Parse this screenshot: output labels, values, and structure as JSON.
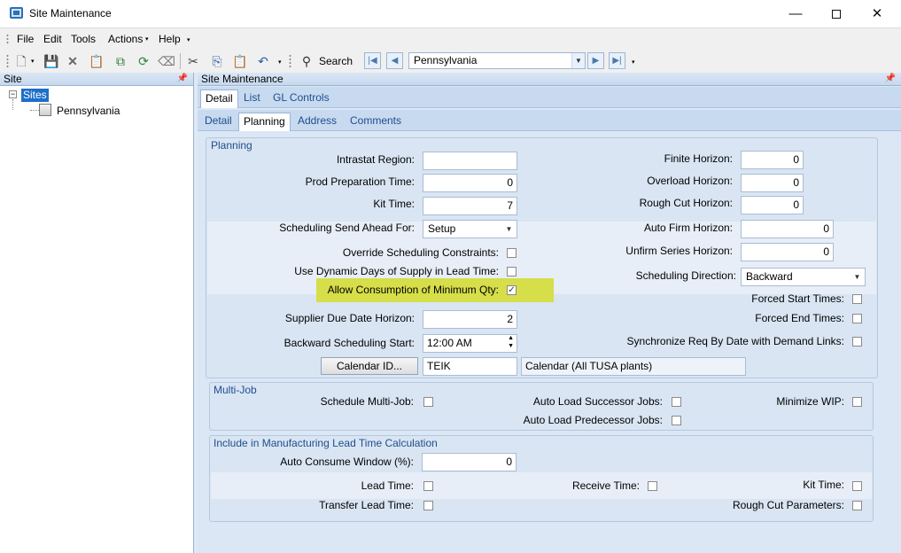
{
  "window": {
    "title": "Site Maintenance",
    "min": "—",
    "close": "✕"
  },
  "menu": [
    "File",
    "Edit",
    "Tools",
    "Actions",
    "Help"
  ],
  "toolbar": {
    "search_label": "Search",
    "site_value": "Pennsylvania"
  },
  "left_pane": {
    "title": "Site",
    "root": "Sites",
    "child": "Pennsylvania"
  },
  "right_pane": {
    "title": "Site Maintenance",
    "top_tabs": [
      "Detail",
      "List",
      "GL Controls"
    ],
    "sub_tabs": [
      "Detail",
      "Planning",
      "Address",
      "Comments"
    ]
  },
  "planning": {
    "title": "Planning",
    "intrastat_region": {
      "label": "Intrastat Region:",
      "value": ""
    },
    "prod_prep_time": {
      "label": "Prod Preparation Time:",
      "value": "0"
    },
    "kit_time": {
      "label": "Kit Time:",
      "value": "7"
    },
    "sched_send_ahead": {
      "label": "Scheduling Send Ahead For:",
      "value": "Setup"
    },
    "override_constraints": {
      "label": "Override Scheduling Constraints:",
      "checked": false
    },
    "dynamic_days": {
      "label": "Use Dynamic Days of Supply in Lead Time:",
      "checked": false
    },
    "allow_consumption": {
      "label": "Allow Consumption of Minimum Qty:",
      "checked": true
    },
    "supplier_due_horizon": {
      "label": "Supplier Due Date Horizon:",
      "value": "2"
    },
    "backward_start": {
      "label": "Backward Scheduling Start:",
      "value": "12:00 AM"
    },
    "calendar_button": "Calendar ID...",
    "calendar_id": "TEIK",
    "calendar_desc": "Calendar (All TUSA plants)",
    "finite_horizon": {
      "label": "Finite Horizon:",
      "value": "0"
    },
    "overload_horizon": {
      "label": "Overload Horizon:",
      "value": "0"
    },
    "rough_cut_horizon": {
      "label": "Rough Cut Horizon:",
      "value": "0"
    },
    "auto_firm_horizon": {
      "label": "Auto Firm Horizon:",
      "value": "0"
    },
    "unfirm_series_horizon": {
      "label": "Unfirm Series Horizon:",
      "value": "0"
    },
    "sched_direction": {
      "label": "Scheduling Direction:",
      "value": "Backward"
    },
    "forced_start": {
      "label": "Forced Start Times:",
      "checked": false
    },
    "forced_end": {
      "label": "Forced End Times:",
      "checked": false
    },
    "sync_req": {
      "label": "Synchronize Req By Date with Demand Links:",
      "checked": false
    }
  },
  "multijob": {
    "title": "Multi-Job",
    "schedule": {
      "label": "Schedule Multi-Job:",
      "checked": false
    },
    "auto_successor": {
      "label": "Auto Load Successor Jobs:",
      "checked": false
    },
    "auto_predecessor": {
      "label": "Auto Load Predecessor Jobs:",
      "checked": false
    },
    "minimize_wip": {
      "label": "Minimize WIP:",
      "checked": false
    }
  },
  "mfg_lead": {
    "title": "Include in Manufacturing Lead Time Calculation",
    "auto_consume": {
      "label": "Auto Consume Window (%):",
      "value": "0"
    },
    "lead_time": {
      "label": "Lead Time:",
      "checked": false
    },
    "receive_time": {
      "label": "Receive Time:",
      "checked": false
    },
    "kit_time": {
      "label": "Kit Time:",
      "checked": false
    },
    "transfer_lead": {
      "label": "Transfer Lead Time:",
      "checked": false
    },
    "rough_cut_params": {
      "label": "Rough Cut Parameters:",
      "checked": false
    }
  },
  "colors": {
    "highlight": "#d6de4a",
    "selection": "#1c6fc9",
    "tab_text": "#1f4e8c"
  }
}
